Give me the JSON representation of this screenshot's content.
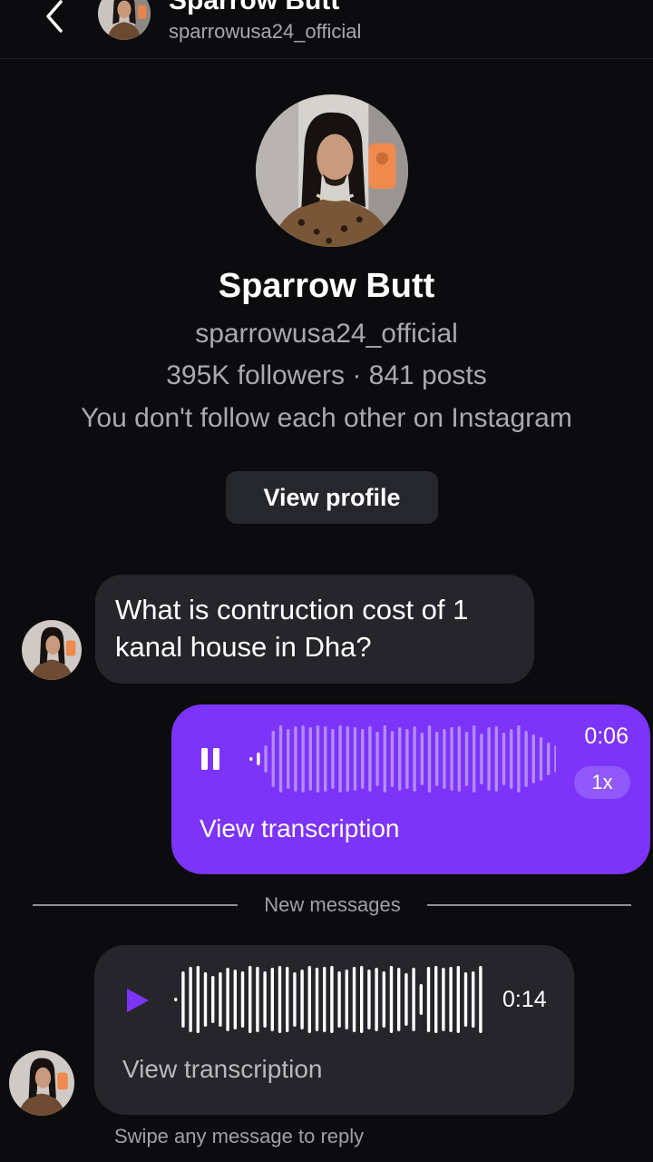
{
  "header": {
    "name": "Sparrow Butt",
    "username": "sparrowusa24_official",
    "back_icon": "chevron-left-icon"
  },
  "profile": {
    "name": "Sparrow Butt",
    "username": "sparrowusa24_official",
    "stats": "395K followers · 841 posts",
    "relationship": "You don't follow each other on Instagram",
    "view_profile_label": "View profile"
  },
  "messages": [
    {
      "type": "text",
      "direction": "incoming",
      "text": "What is contruction cost of 1 kanal house in Dha?"
    },
    {
      "type": "voice",
      "direction": "outgoing",
      "state": "playing",
      "control_icon": "pause-icon",
      "duration": "0:06",
      "speed": "1x",
      "transcription_label": "View transcription",
      "progress": 0.05
    },
    {
      "type": "divider",
      "label": "New messages"
    },
    {
      "type": "voice",
      "direction": "incoming",
      "state": "paused",
      "control_icon": "play-icon",
      "duration": "0:14",
      "transcription_label": "View transcription"
    }
  ],
  "footer": {
    "hint": "Swipe any message to reply"
  },
  "colors": {
    "background": "#0c0c0f",
    "outgoing_bubble": "#7c34f8",
    "incoming_bubble": "#25252b",
    "play_accent": "#7c34f8",
    "secondary_text": "#a9a9af"
  }
}
